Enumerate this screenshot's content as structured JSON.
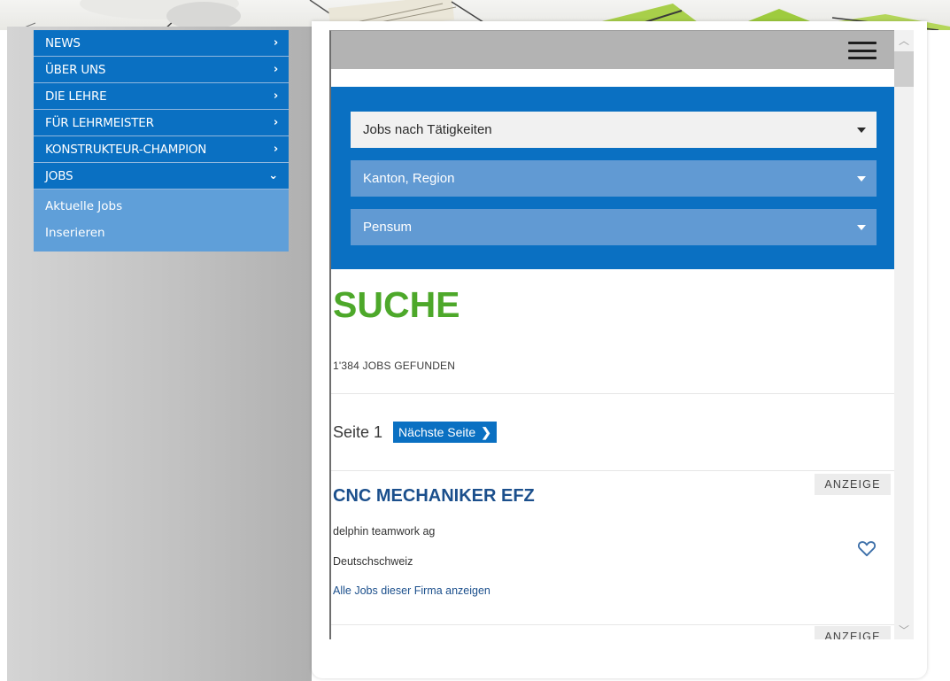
{
  "sidebar": {
    "items": [
      {
        "label": "NEWS",
        "chevron": "›"
      },
      {
        "label": "ÜBER UNS",
        "chevron": "›"
      },
      {
        "label": "DIE LEHRE",
        "chevron": "›"
      },
      {
        "label": "FÜR LEHRMEISTER",
        "chevron": "›"
      },
      {
        "label": "KONSTRUKTEUR-CHAMPION",
        "chevron": "›"
      },
      {
        "label": "JOBS",
        "chevron": "⌄"
      }
    ],
    "sub_items": [
      {
        "label": "Aktuelle Jobs"
      },
      {
        "label": "Inserieren"
      }
    ]
  },
  "filters": {
    "activity": "Jobs nach Tätigkeiten",
    "region": "Kanton, Region",
    "pensum": "Pensum"
  },
  "results": {
    "title": "SUCHE",
    "count_text": "1'384 JOBS GEFUNDEN"
  },
  "pager": {
    "page_label": "Seite 1",
    "next_label": "Nächste Seite",
    "next_chevron": "❯"
  },
  "jobs": [
    {
      "badge": "ANZEIGE",
      "title": "CNC MECHANIKER EFZ",
      "company": "delphin teamwork ag",
      "location": "Deutschschweiz",
      "company_link": "Alle Jobs dieser Firma anzeigen"
    },
    {
      "badge": "ANZEIGE"
    }
  ],
  "scrollbar": {
    "up_glyph": "︿",
    "down_glyph": "﹀"
  },
  "colors": {
    "brand_blue": "#0a70c2",
    "light_blue": "#619ad3",
    "submenu_blue": "#5f9fd9",
    "title_green": "#4da82a",
    "job_title_blue": "#1b4f8c"
  },
  "icons": {
    "menu": "hamburger-menu-icon",
    "favorite": "heart-icon",
    "dropdown": "caret-down-icon"
  }
}
